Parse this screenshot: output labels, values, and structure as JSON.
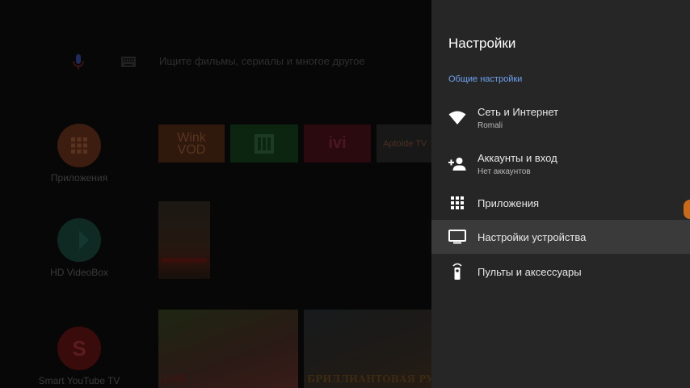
{
  "launcher": {
    "search_placeholder": "Ищите фильмы, сериалы и многое другое",
    "side_apps": [
      {
        "label": "Приложения"
      },
      {
        "label": "HD VideoBox"
      },
      {
        "label": "Smart YouTube TV",
        "icon_letter": "S"
      }
    ],
    "tiles": {
      "wink_line1": "Wink",
      "wink_line2": "VOD",
      "ivi": "ivi",
      "aptoide": "Aptoide TV"
    },
    "thumb_live": "LIVE",
    "thumb_caption": "БРИЛЛИАНТОВАЯ РУКА"
  },
  "settings": {
    "title": "Настройки",
    "section": "Общие настройки",
    "items": [
      {
        "label": "Сеть и Интернет",
        "sublabel": "Romali",
        "icon": "wifi-icon"
      },
      {
        "label": "Аккаунты и вход",
        "sublabel": "Нет аккаунтов",
        "icon": "add-person-icon"
      },
      {
        "label": "Приложения",
        "icon": "apps-grid-icon"
      },
      {
        "label": "Настройки устройства",
        "icon": "tv-icon",
        "selected": true
      },
      {
        "label": "Пульты и аксессуары",
        "icon": "remote-icon"
      }
    ]
  },
  "colors": {
    "panel_bg": "#262626",
    "selected_bg": "#3a3a3a",
    "section_accent": "#6ea3f0",
    "background": "#070707"
  }
}
